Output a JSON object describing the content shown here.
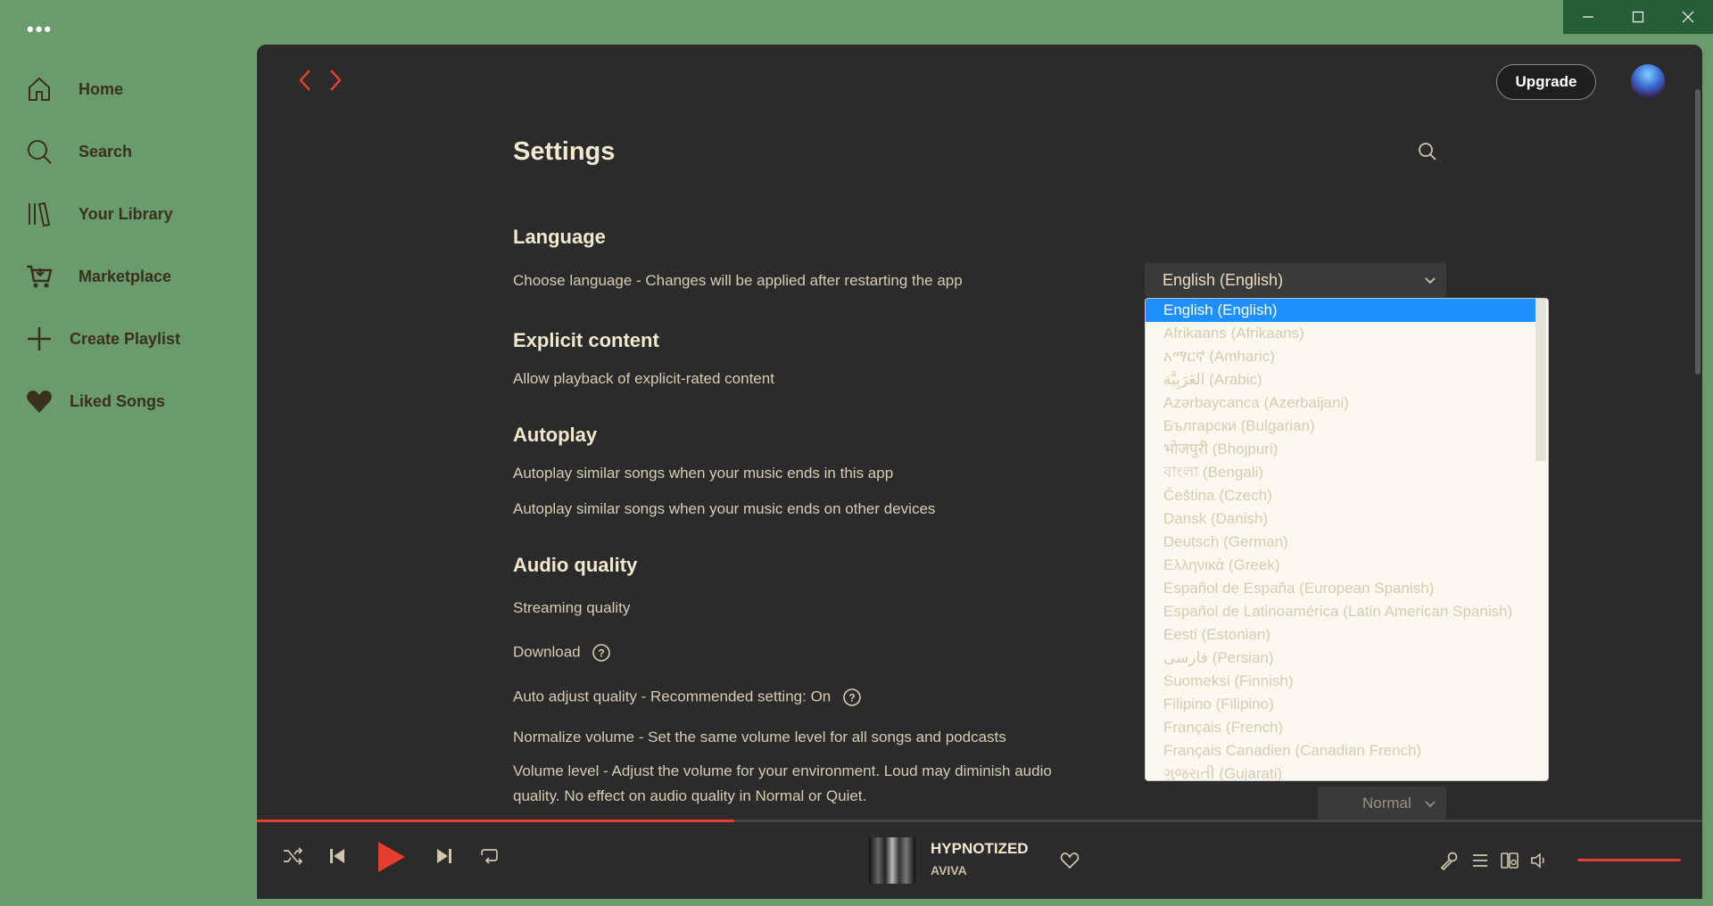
{
  "window": {
    "menu_dots": "•••"
  },
  "sidebar": {
    "items": [
      {
        "label": "Home"
      },
      {
        "label": "Search"
      },
      {
        "label": "Your Library"
      },
      {
        "label": "Marketplace"
      },
      {
        "label": "Create Playlist"
      },
      {
        "label": "Liked Songs"
      }
    ]
  },
  "header": {
    "upgrade_label": "Upgrade"
  },
  "settings": {
    "title": "Settings",
    "language": {
      "heading": "Language",
      "desc": "Choose language - Changes will be applied after restarting the app",
      "selected": "English (English)"
    },
    "explicit": {
      "heading": "Explicit content",
      "desc": "Allow playback of explicit-rated content"
    },
    "autoplay": {
      "heading": "Autoplay",
      "desc1": "Autoplay similar songs when your music ends in this app",
      "desc2": "Autoplay similar songs when your music ends on other devices"
    },
    "audio": {
      "heading": "Audio quality",
      "streaming": "Streaming quality",
      "download": "Download",
      "auto_adjust": "Auto adjust quality - Recommended setting: On",
      "normalize": "Normalize volume - Set the same volume level for all songs and podcasts",
      "volume_level": "Volume level - Adjust the volume for your environment. Loud may diminish audio quality. No effect on audio quality in Normal or Quiet.",
      "volume_select": "Normal"
    }
  },
  "dropdown": {
    "options": [
      "English (English)",
      "Afrikaans (Afrikaans)",
      "አማርኛ (Amharic)",
      "العَرَبِيَّة (Arabic)",
      "Azərbaycanca (Azerbaijani)",
      "Български (Bulgarian)",
      "भोजपुरी (Bhojpuri)",
      "বাংলা (Bengali)",
      "Čeština (Czech)",
      "Dansk (Danish)",
      "Deutsch (German)",
      "Ελληνικά (Greek)",
      "Español de España (European Spanish)",
      "Español de Latinoamérica (Latin American Spanish)",
      "Eesti (Estonian)",
      "فارسی (Persian)",
      "Suomeksi (Finnish)",
      "Filipino (Filipino)",
      "Français (French)",
      "Français Canadien (Canadian French)",
      "ગુજરાતી (Gujarati)"
    ],
    "selected_index": 0
  },
  "player": {
    "title": "HYPNOTIZED",
    "artist": "AVIVA",
    "progress": 0.33,
    "volume": 1.0
  },
  "colors": {
    "accent": "#e53d2e",
    "background": "#6a9b6d",
    "panel": "#2b2b2b",
    "selection": "#1e90ff"
  }
}
